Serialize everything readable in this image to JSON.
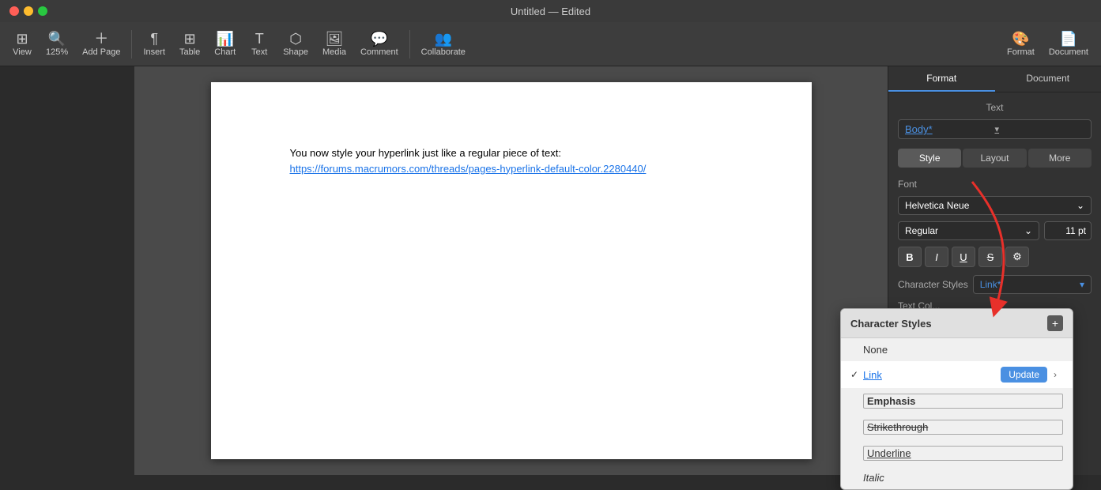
{
  "window": {
    "title": "Untitled — Edited"
  },
  "toolbar": {
    "view_label": "View",
    "zoom_label": "Zoom",
    "zoom_value": "125%",
    "add_page_label": "Add Page",
    "insert_label": "Insert",
    "table_label": "Table",
    "chart_label": "Chart",
    "text_label": "Text",
    "shape_label": "Shape",
    "media_label": "Media",
    "comment_label": "Comment",
    "collaborate_label": "Collaborate",
    "format_label": "Format",
    "document_label": "Document"
  },
  "document": {
    "text": "You now style your hyperlink just like a regular piece of text: ",
    "link_text": "https://forums.macrumors.com/threads/pages-hyperlink-default-color.2280440/"
  },
  "right_panel": {
    "section_title": "Text",
    "panel_tabs": [
      {
        "label": "Format",
        "active": true
      },
      {
        "label": "Document",
        "active": false
      }
    ],
    "style_dropdown": {
      "value": "Body*"
    },
    "sub_tabs": [
      {
        "label": "Style",
        "active": true
      },
      {
        "label": "Layout",
        "active": false
      },
      {
        "label": "More",
        "active": false
      }
    ],
    "font_section": {
      "label": "Font",
      "font_name": "Helvetica Neue",
      "font_style": "Regular",
      "font_size": "11 pt"
    },
    "style_buttons": [
      "B",
      "I",
      "U",
      "S"
    ],
    "char_styles": {
      "label": "Character Styles",
      "value": "Link*"
    },
    "text_color_label": "Text Col..."
  },
  "char_styles_popup": {
    "title": "Character Styles",
    "add_btn_label": "+",
    "items": [
      {
        "label": "None",
        "selected": false,
        "style": "normal"
      },
      {
        "label": "Link",
        "selected": true,
        "style": "link",
        "show_update": true
      },
      {
        "label": "Emphasis",
        "selected": false,
        "style": "emphasis"
      },
      {
        "label": "Strikethrough",
        "selected": false,
        "style": "strikethrough"
      },
      {
        "label": "Underline",
        "selected": false,
        "style": "underline"
      },
      {
        "label": "Italic",
        "selected": false,
        "style": "italic"
      }
    ],
    "update_btn_label": "Update"
  }
}
